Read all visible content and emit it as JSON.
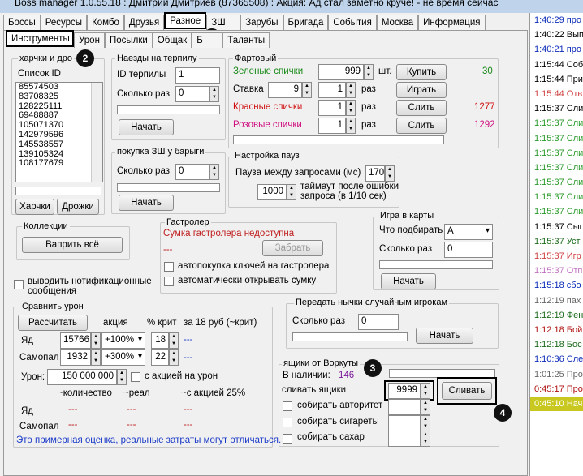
{
  "window": {
    "title": "Boss manager 1.0.55.18 : Дмитрий Дмитриев (87365508) : Акция: Ад стал заметно круче! - не время сейчас"
  },
  "main_tabs": [
    "Боссы",
    "Ресурсы",
    "Комбо",
    "Друзья",
    "Разное",
    "ЗШ",
    "Зарубы",
    "Бригада",
    "События",
    "Москва",
    "Информация"
  ],
  "sub_tabs": [
    "Инструменты",
    "Урон",
    "Посылки",
    "Общак",
    "Б",
    "Таланты"
  ],
  "markers": [
    "1",
    "2",
    "3",
    "4"
  ],
  "tools": {
    "charki_title": "харчки и дро",
    "list_id_label": "Список ID",
    "ids": [
      "85574503",
      "83708325",
      "128225111",
      "69488887",
      "105071370",
      "142979596",
      "145538557",
      "139105324",
      "108177679"
    ],
    "btn_charki": "Харчки",
    "btn_drozhki": "Дрожки"
  },
  "raid": {
    "title": "Наезды на терпилу",
    "id_label": "ID терпилы",
    "id_value": "1",
    "count_label": "Сколько раз",
    "count_value": "0",
    "start": "Начать"
  },
  "zsh": {
    "title": "покупка ЗШ у барыги",
    "count_label": "Сколько раз",
    "count_value": "0",
    "start": "Начать"
  },
  "lucky": {
    "title": "Фартовый",
    "green_label": "Зеленые спички",
    "green_value": "999",
    "green_unit": "шт.",
    "buy": "Купить",
    "green_count": "30",
    "bet_label": "Ставка",
    "bet_value": "9",
    "bet_times": "1",
    "bet_unit": "раз",
    "play": "Играть",
    "red_label": "Красные спички",
    "red_times": "1",
    "red_unit": "раз",
    "merge": "Слить",
    "red_count": "1277",
    "pink_label": "Розовые спички",
    "pink_times": "1",
    "pink_unit": "раз",
    "merge2": "Слить",
    "pink_count": "1292",
    "green_color": "#1a8a1a",
    "red_color": "#d01010",
    "pink_color": "#d01080"
  },
  "pause": {
    "title": "Настройка пауз",
    "between_label": "Пауза между запросами (мс)",
    "between_value": "170",
    "timeout_value": "1000",
    "timeout_label1": "таймаут после ошибки",
    "timeout_label2": "запроса (в 1/10 сек)"
  },
  "collections": {
    "title": "Коллекции",
    "btn": "Ваприть всё"
  },
  "tour": {
    "title": "Гастролер",
    "status": "Сумка гастролера недоступна",
    "dash": "---",
    "pick": "Забрать",
    "auto_keys": "автопокупка ключей на гастролера",
    "auto_bag": "автоматически открывать сумку"
  },
  "cards": {
    "title": "Игра в карты",
    "pick_label": "Что подбирать",
    "pick_value": "А",
    "count_label": "Сколько раз",
    "count_value": "0",
    "start": "Начать"
  },
  "notify": {
    "label1": "выводить нотификационные",
    "label2": "сообщения"
  },
  "damage": {
    "title": "Сравнить урон",
    "calc": "Рассчитать",
    "promo": "акция",
    "crit": "% крит",
    "cost": "за 18 руб (~крит)",
    "yad_label": "Яд",
    "yad_value": "15766",
    "yad_promo": "+100%",
    "yad_crit": "18",
    "samopal_label": "Самопал",
    "samopal_value": "1932",
    "samopal_promo": "+300%",
    "samopal_crit": "22",
    "dash": "---",
    "uron_label": "Урон:",
    "uron_value": "150 000 000",
    "with_promo": "с акцией на урон",
    "h_count": "~количество",
    "h_real": "~реал",
    "h_promo": "~с акцией 25%",
    "note": "Это примерная оценка, реальные затраты могут отличаться."
  },
  "gift": {
    "title": "Передать нычки случайным игрокам",
    "count_label": "Сколько раз",
    "count_value": "0",
    "start": "Начать"
  },
  "vorkuta": {
    "title": "ящики от Воркуты",
    "have_label": "В наличии:",
    "have_value": "146",
    "merge_label": "сливать ящики",
    "merge_value": "9999",
    "merge_btn": "Сливать",
    "auth": "собирать авторитет",
    "cig": "собирать сигареты",
    "sugar": "собирать сахар"
  },
  "log": [
    {
      "t": "1:40:29 про",
      "c": "#0b2bb8"
    },
    {
      "t": "1:40:22 Вып",
      "c": "#000"
    },
    {
      "t": "1:40:21 про",
      "c": "#0b2bb8"
    },
    {
      "t": "1:15:44 Собр",
      "c": "#000"
    },
    {
      "t": "1:15:44 При",
      "c": "#000"
    },
    {
      "t": "1:15:44 Отв",
      "c": "#d04040"
    },
    {
      "t": "1:15:37 Сли",
      "c": "#000"
    },
    {
      "t": "1:15:37 Сли",
      "c": "#2a9a2a"
    },
    {
      "t": "1:15:37 Сли",
      "c": "#2a9a2a"
    },
    {
      "t": "1:15:37 Сли",
      "c": "#2a9a2a"
    },
    {
      "t": "1:15:37 Сли",
      "c": "#2a9a2a"
    },
    {
      "t": "1:15:37 Сли",
      "c": "#2a9a2a"
    },
    {
      "t": "1:15:37 Сли",
      "c": "#2a9a2a"
    },
    {
      "t": "1:15:37 Сли",
      "c": "#2a9a2a"
    },
    {
      "t": "1:15:37 Сыг",
      "c": "#000"
    },
    {
      "t": "1:15:37 Уст",
      "c": "#1a6a1a"
    },
    {
      "t": "1:15:37 Игр",
      "c": "#d04040"
    },
    {
      "t": "1:15:37 Отп",
      "c": "#c070c0"
    },
    {
      "t": "1:15:18 сбо",
      "c": "#0b2bb8"
    },
    {
      "t": "1:12:19 пах",
      "c": "#666"
    },
    {
      "t": "1:12:19 Фен",
      "c": "#1a6a1a"
    },
    {
      "t": "1:12:18 Бой",
      "c": "#b01010"
    },
    {
      "t": "1:12:18 Бос",
      "c": "#1a6a1a"
    },
    {
      "t": "1:10:36 Сле",
      "c": "#0b2bb8"
    },
    {
      "t": "1:01:25 Про",
      "c": "#666"
    },
    {
      "t": "0:45:17 Про",
      "c": "#b01010"
    },
    {
      "t": "0:45:10 Нач",
      "c": "#fff",
      "bg": "#c8c820"
    }
  ]
}
